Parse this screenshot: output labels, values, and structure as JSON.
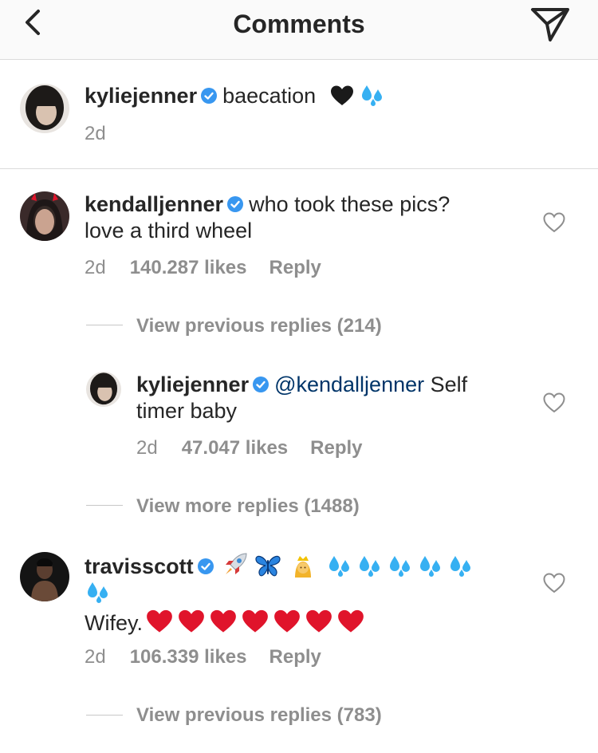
{
  "header": {
    "title": "Comments"
  },
  "caption": {
    "username": "kyliejenner",
    "text": "baecation",
    "time": "2d"
  },
  "comments": [
    {
      "username": "kendalljenner",
      "text": "who took these pics?",
      "text_line2": "love a third wheel",
      "time": "2d",
      "likes": "140.287 likes",
      "reply_label": "Reply",
      "view_replies": "View previous replies (214)"
    },
    {
      "username": "kyliejenner",
      "mention": "@kendalljenner",
      "text": " Self",
      "text_line2": "timer baby",
      "time": "2d",
      "likes": "47.047 likes",
      "reply_label": "Reply",
      "view_replies": "View more replies (1488)"
    },
    {
      "username": "travisscott",
      "text_line2": "Wifey.",
      "time": "2d",
      "likes": "106.339 likes",
      "reply_label": "Reply",
      "view_replies": "View previous replies (783)"
    }
  ],
  "colors": {
    "text": "#262626",
    "meta": "#8e8e8e",
    "verified": "#3897f0",
    "mention": "#003569",
    "heart_red": "#e0142b",
    "divider": "#dbdbdb"
  }
}
